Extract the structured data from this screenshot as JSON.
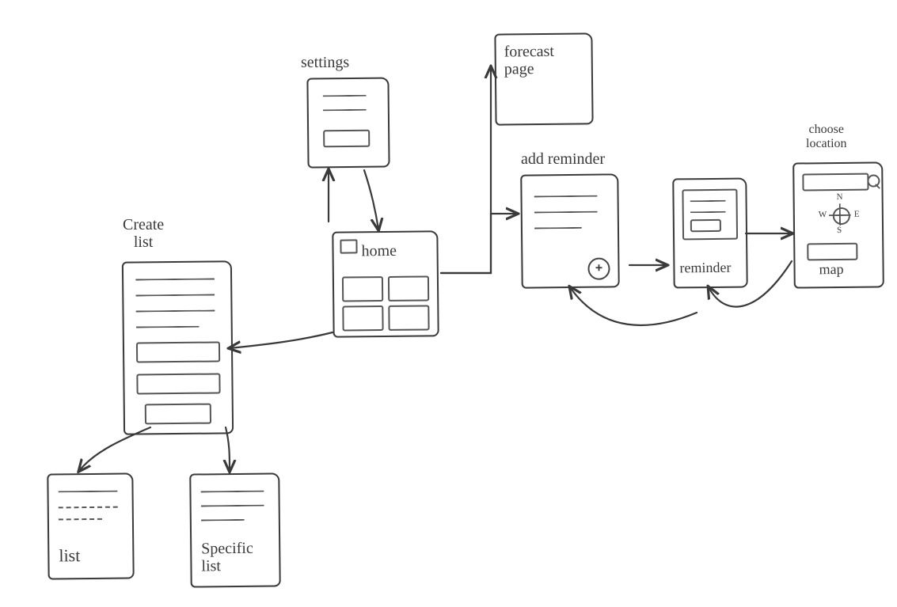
{
  "labels": {
    "settings": "settings",
    "forecast": "forecast\npage",
    "addReminder": "add reminder",
    "reminder": "reminder",
    "chooseLocation": "choose\nlocation",
    "map": "map",
    "home": "home",
    "createList": "Create\nlist",
    "list": "list",
    "specificList": "Specific\nlist",
    "compassN": "N",
    "compassS": "S",
    "compassE": "E",
    "compassW": "W"
  }
}
